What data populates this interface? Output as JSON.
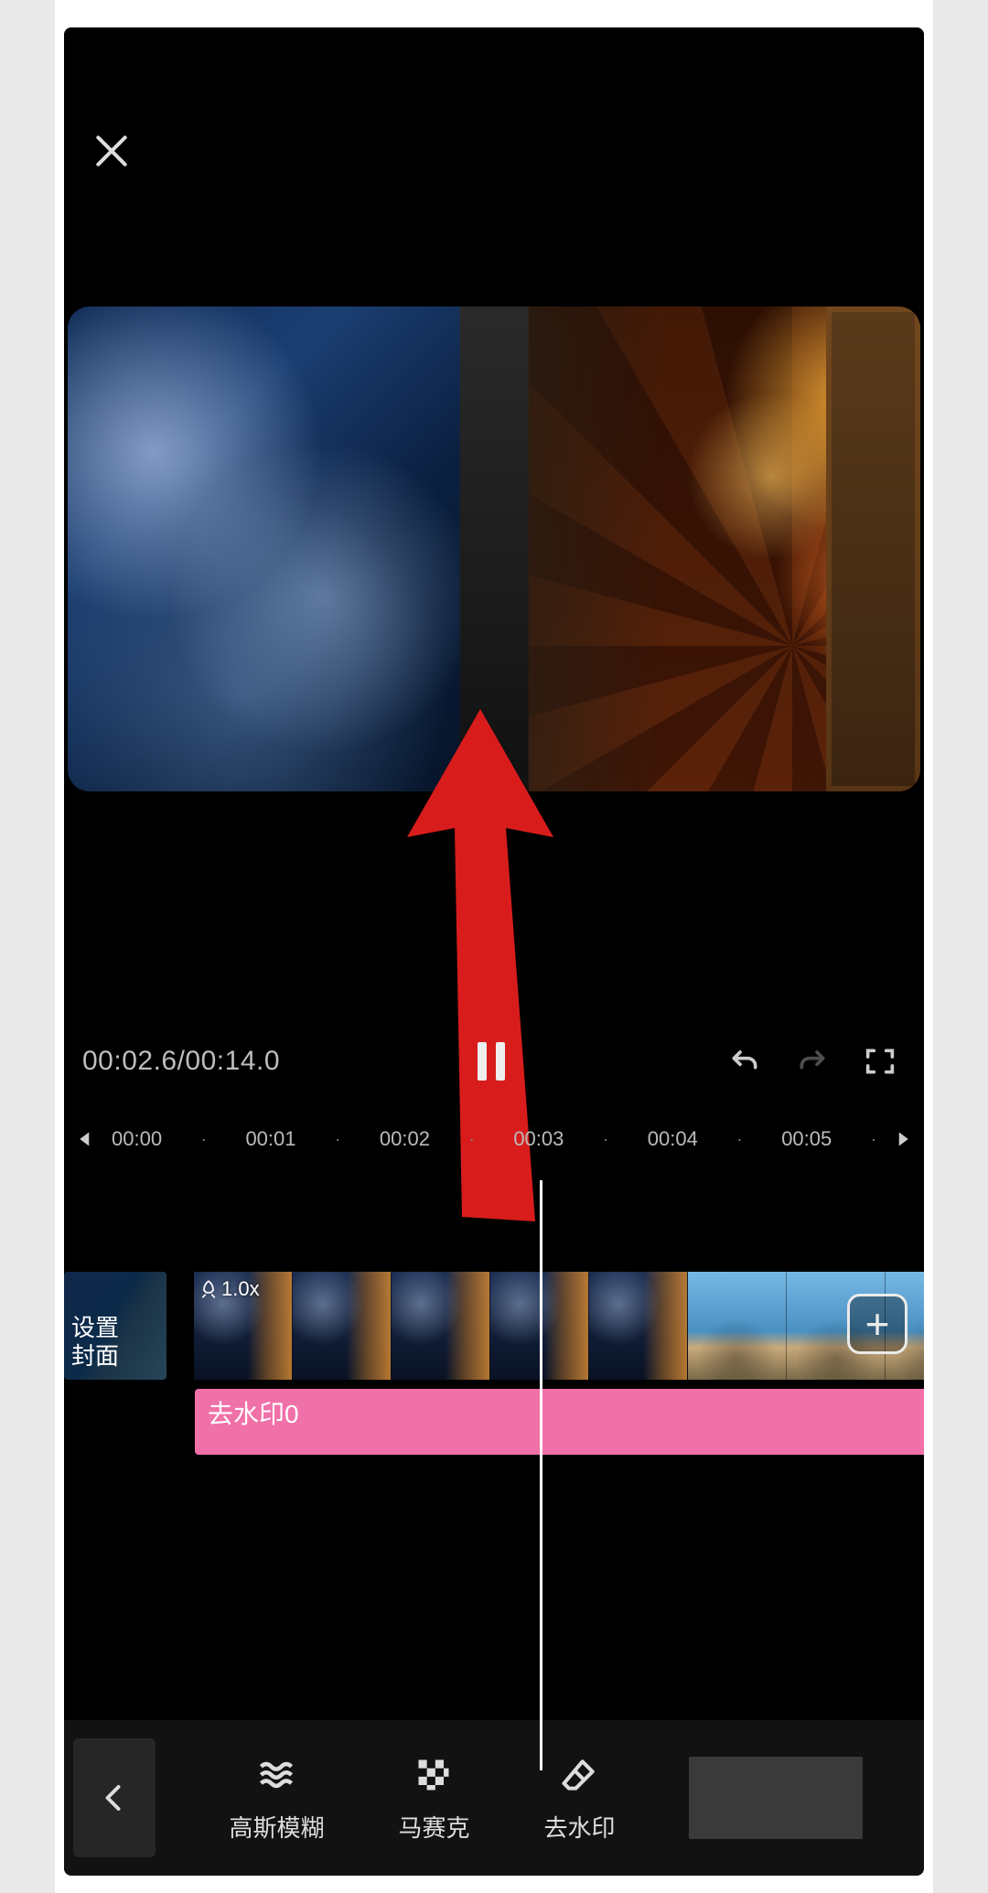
{
  "playback": {
    "timecode": "00:02.6/00:14.0"
  },
  "ruler": {
    "ticks": [
      "00:00",
      "00:01",
      "00:02",
      "00:03",
      "00:04",
      "00:05"
    ]
  },
  "timeline": {
    "cover_label_line1": "设置",
    "cover_label_line2": "封面",
    "speed_badge": "1.0x",
    "effect_label": "去水印0",
    "add_label": "+"
  },
  "toolbar": {
    "items": [
      {
        "id": "gaussian-blur",
        "label": "高斯模糊"
      },
      {
        "id": "mosaic",
        "label": "马赛克"
      },
      {
        "id": "remove-watermark",
        "label": "去水印"
      }
    ]
  },
  "annotation": {
    "arrow_color": "#d81f1f"
  }
}
